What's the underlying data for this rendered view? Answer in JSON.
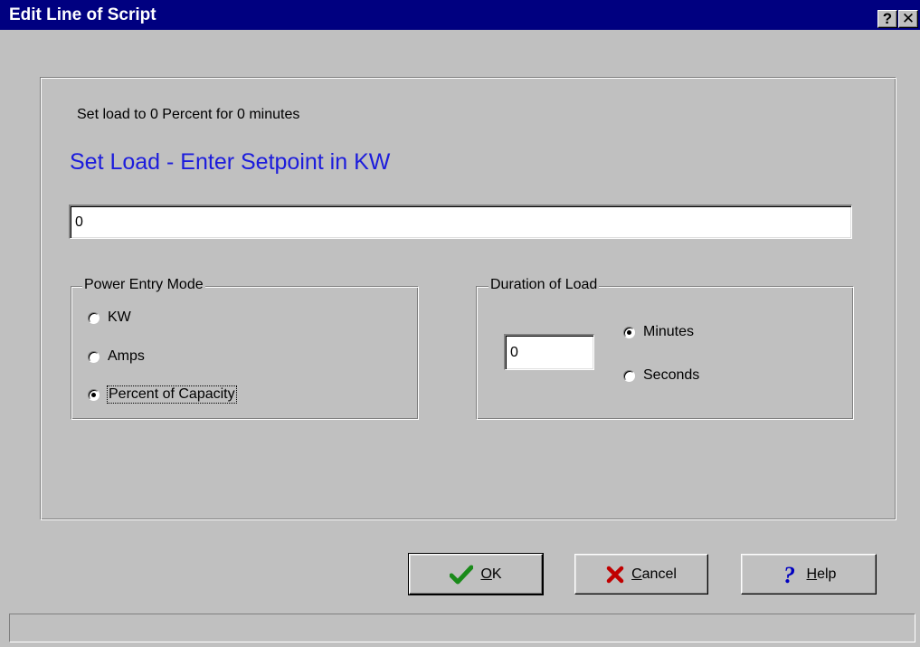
{
  "window": {
    "title": "Edit Line of Script",
    "help_glyph": "?",
    "close_glyph": "✕"
  },
  "summary_text": "Set load to 0 Percent for 0 minutes",
  "heading": "Set Load - Enter Setpoint in KW",
  "colors": {
    "titlebar": "#000080",
    "heading": "#1c1cdc",
    "ok_check": "#1a8a1a",
    "cancel_x": "#c00000",
    "help_q": "#0000c0"
  },
  "setpoint": {
    "value": "0"
  },
  "power_entry_mode": {
    "label": "Power Entry Mode",
    "options": [
      {
        "label": "KW",
        "checked": false
      },
      {
        "label": "Amps",
        "checked": false
      },
      {
        "label": "Percent of Capacity",
        "checked": true
      }
    ]
  },
  "duration": {
    "label": "Duration of Load",
    "value": "0",
    "options": [
      {
        "label": "Minutes",
        "checked": true
      },
      {
        "label": "Seconds",
        "checked": false
      }
    ]
  },
  "buttons": {
    "ok": {
      "mnemonic": "O",
      "rest": "K",
      "icon": "check-icon"
    },
    "cancel": {
      "mnemonic": "C",
      "rest": "ancel",
      "icon": "x-icon"
    },
    "help": {
      "mnemonic": "H",
      "rest": "elp",
      "icon": "question-icon"
    }
  },
  "status_text": ""
}
